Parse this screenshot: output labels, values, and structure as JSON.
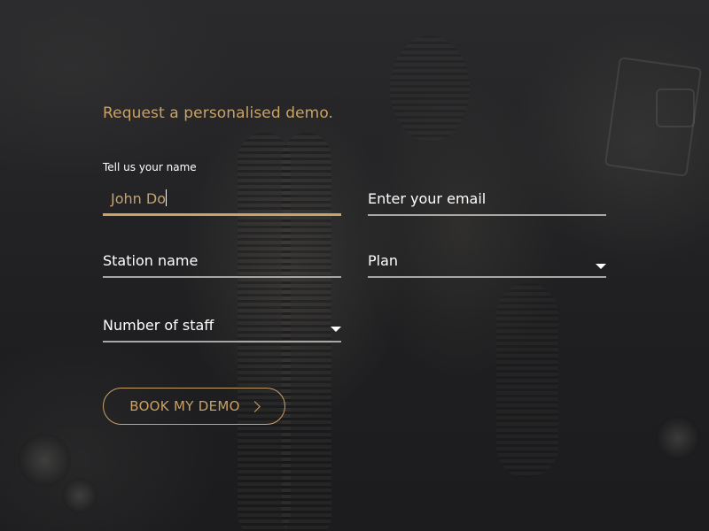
{
  "form": {
    "heading": "Request a personalised demo.",
    "name_field": {
      "label": "Tell us your name",
      "value": "John Do"
    },
    "email_field": {
      "placeholder": "Enter your email"
    },
    "station_field": {
      "placeholder": "Station name"
    },
    "plan_field": {
      "placeholder": "Plan",
      "icon": "chevron-down-icon"
    },
    "staff_field": {
      "placeholder": "Number of staff",
      "icon": "chevron-down-icon"
    },
    "submit_button": {
      "label": "BOOK MY DEMO",
      "icon": "chevron-right-icon"
    }
  },
  "colors": {
    "accent": "#c9a266",
    "background": "#232326",
    "text": "#ffffff",
    "underline": "#a9a7a3"
  }
}
